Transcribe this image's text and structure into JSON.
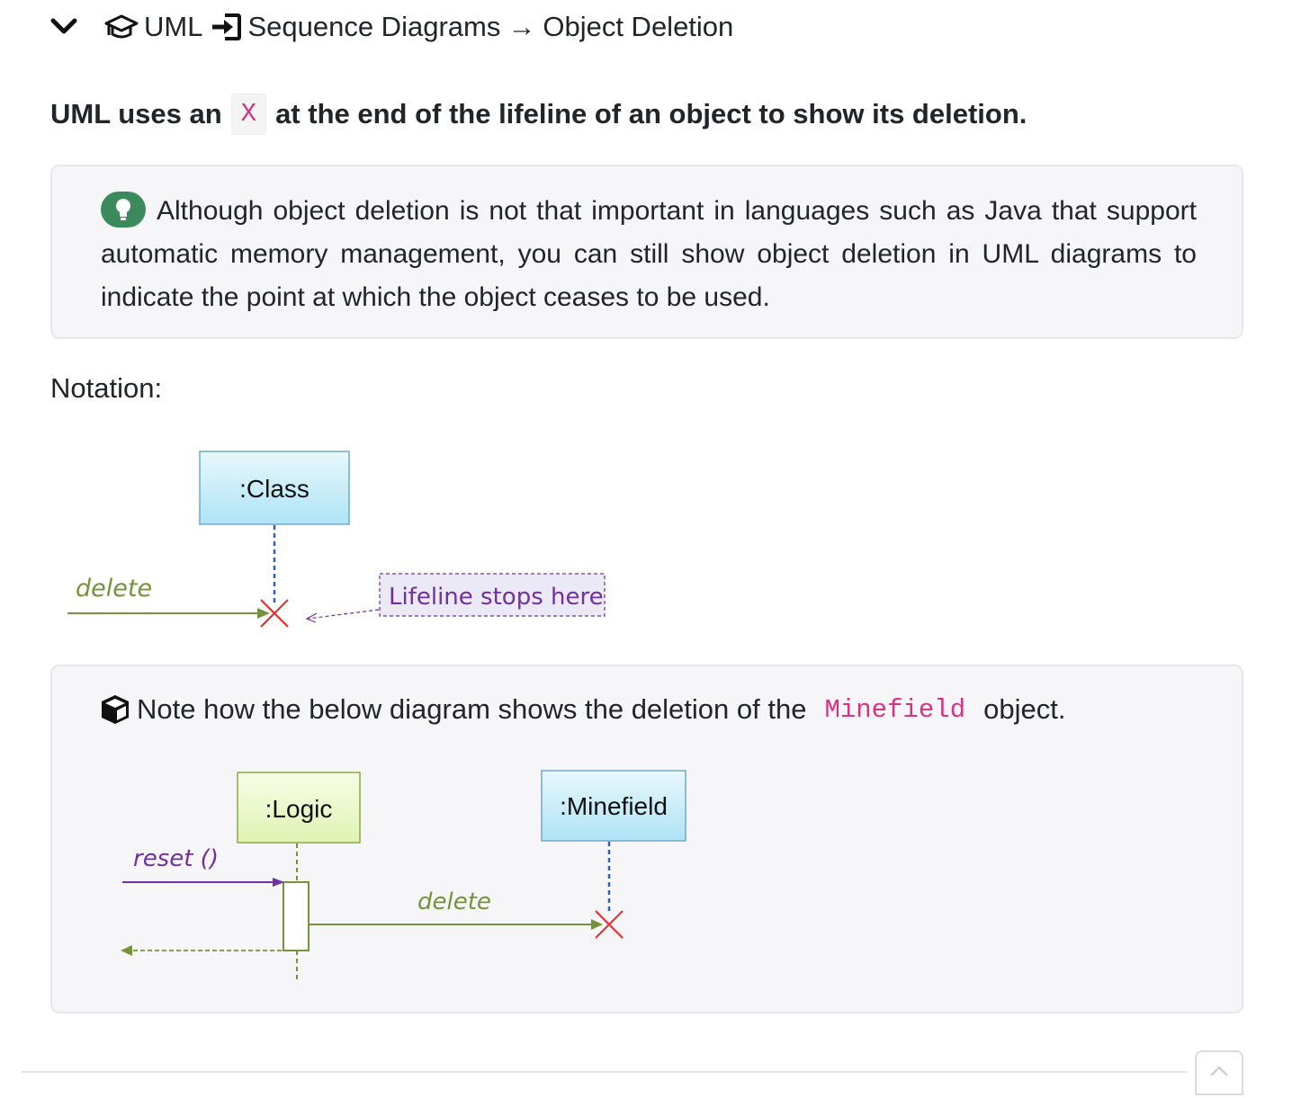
{
  "breadcrumb": {
    "items": [
      "UML",
      "Sequence Diagrams",
      "Object Deletion"
    ],
    "separator_arrow": "→"
  },
  "lead": {
    "before": "UML uses an",
    "code": "X",
    "after": "at the end of the lifeline of an object to show its deletion."
  },
  "tip": {
    "icon": "lightbulb-icon",
    "text": "Although object deletion is not that important in languages such as Java that support automatic memory management, you can still show object deletion in UML diagrams to indicate the point at which the object ceases to be used."
  },
  "notation_label": "Notation:",
  "diagram1": {
    "object_label": ":Class",
    "message_label": "delete",
    "note_label": "Lifeline stops here"
  },
  "note": {
    "icon": "cube-icon",
    "before": "Note how the below diagram shows the deletion of the",
    "code": "Minefield",
    "after": "object."
  },
  "diagram2": {
    "logic_label": ":Logic",
    "minefield_label": ":Minefield",
    "reset_label": "reset ()",
    "delete_label": "delete"
  },
  "colors": {
    "code": "#d63384",
    "tip_icon_green": "#3a8a5c",
    "class_box_blue": "#bfe9f7",
    "logic_box_green": "#ecf8c7",
    "message_olive": "#76933c",
    "reset_purple": "#7030a0",
    "delete_x_red": "#e8282a",
    "lifeline_blue": "#2e5fb0"
  }
}
